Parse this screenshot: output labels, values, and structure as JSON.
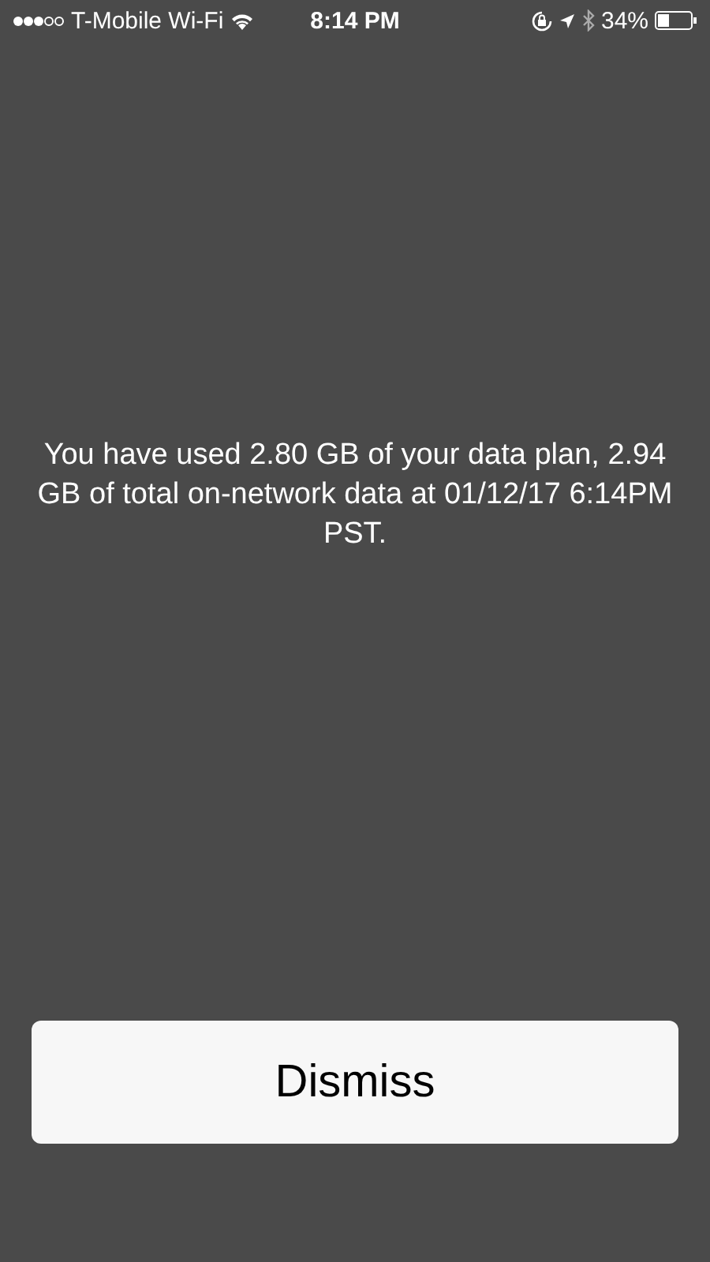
{
  "status_bar": {
    "carrier": "T-Mobile Wi-Fi",
    "time": "8:14 PM",
    "battery": "34%"
  },
  "message": "You have used 2.80 GB of your data plan, 2.94 GB of total on-network data at 01/12/17 6:14PM PST.",
  "buttons": [
    "Dismiss"
  ]
}
